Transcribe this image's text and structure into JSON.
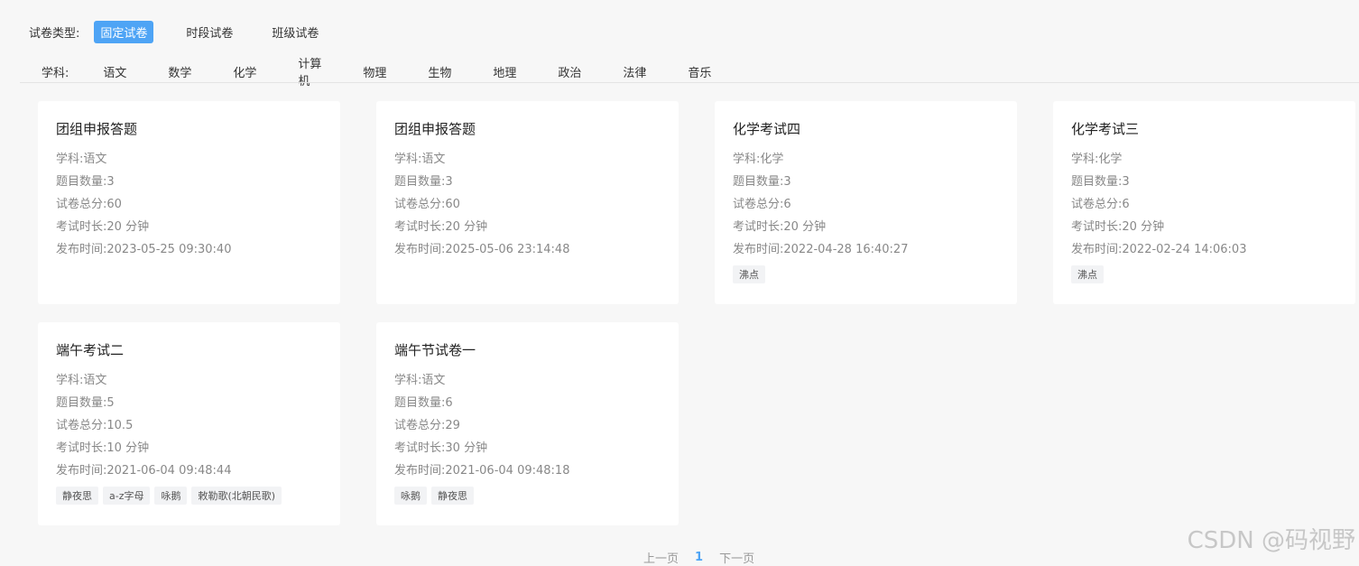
{
  "filters": {
    "type_label": "试卷类型:",
    "types": [
      "固定试卷",
      "时段试卷",
      "班级试卷"
    ],
    "active_type": "固定试卷",
    "subject_label": "学科:",
    "subjects": [
      "语文",
      "数学",
      "化学",
      "计算机",
      "物理",
      "生物",
      "地理",
      "政治",
      "法律",
      "音乐"
    ]
  },
  "labels": {
    "subject": "学科:",
    "question_count": "题目数量:",
    "total_score": "试卷总分:",
    "duration": "考试时长:",
    "publish_time": "发布时间:"
  },
  "cards": [
    {
      "title": "团组申报答题",
      "subject": "语文",
      "question_count": "3",
      "total_score": "60",
      "duration": "20 分钟",
      "publish_time": "2023-05-25 09:30:40",
      "tags": []
    },
    {
      "title": "团组申报答题",
      "subject": "语文",
      "question_count": "3",
      "total_score": "60",
      "duration": "20 分钟",
      "publish_time": "2025-05-06 23:14:48",
      "tags": []
    },
    {
      "title": "化学考试四",
      "subject": "化学",
      "question_count": "3",
      "total_score": "6",
      "duration": "20 分钟",
      "publish_time": "2022-04-28 16:40:27",
      "tags": [
        "沸点"
      ]
    },
    {
      "title": "化学考试三",
      "subject": "化学",
      "question_count": "3",
      "total_score": "6",
      "duration": "20 分钟",
      "publish_time": "2022-02-24 14:06:03",
      "tags": [
        "沸点"
      ]
    },
    {
      "title": "端午考试二",
      "subject": "语文",
      "question_count": "5",
      "total_score": "10.5",
      "duration": "10 分钟",
      "publish_time": "2021-06-04 09:48:44",
      "tags": [
        "静夜思",
        "a-z字母",
        "咏鹅",
        "敕勒歌(北朝民歌)"
      ]
    },
    {
      "title": "端午节试卷一",
      "subject": "语文",
      "question_count": "6",
      "total_score": "29",
      "duration": "30 分钟",
      "publish_time": "2021-06-04 09:48:18",
      "tags": [
        "咏鹅",
        "静夜思"
      ]
    }
  ],
  "pager": {
    "prev": "上一页",
    "current": "1",
    "next": "下一页"
  },
  "watermark": "CSDN @码视野"
}
